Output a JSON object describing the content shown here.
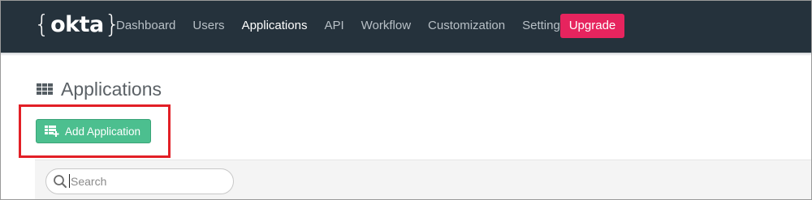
{
  "logo": {
    "open_brace": "{",
    "text": "okta",
    "close_brace": "}"
  },
  "nav": {
    "items": [
      {
        "label": "Dashboard",
        "active": false
      },
      {
        "label": "Users",
        "active": false
      },
      {
        "label": "Applications",
        "active": true
      },
      {
        "label": "API",
        "active": false
      },
      {
        "label": "Workflow",
        "active": false
      },
      {
        "label": "Customization",
        "active": false
      },
      {
        "label": "Settings",
        "active": false
      }
    ],
    "upgrade_label": "Upgrade"
  },
  "page": {
    "title": "Applications",
    "title_icon": "grid-icon"
  },
  "actions": {
    "add_application_label": "Add Application",
    "add_application_icon": "add-app-icon"
  },
  "search": {
    "placeholder": "Search",
    "value": ""
  },
  "colors": {
    "nav_background": "#25323c",
    "upgrade_button": "#e6245e",
    "add_button": "#4cbf8f",
    "highlight": "#e21f26"
  }
}
